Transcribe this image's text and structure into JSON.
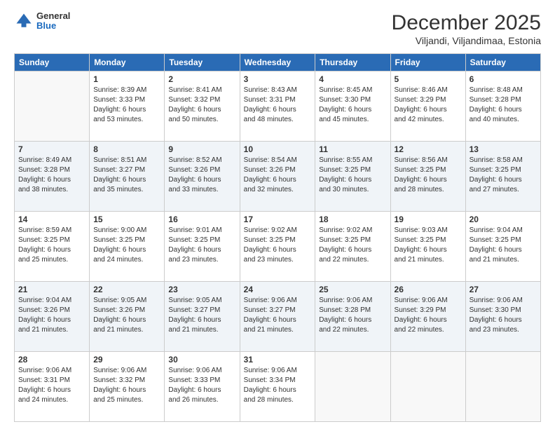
{
  "header": {
    "logo": {
      "general": "General",
      "blue": "Blue"
    },
    "title": "December 2025",
    "subtitle": "Viljandi, Viljandimaa, Estonia"
  },
  "weekdays": [
    "Sunday",
    "Monday",
    "Tuesday",
    "Wednesday",
    "Thursday",
    "Friday",
    "Saturday"
  ],
  "weeks": [
    [
      {
        "day": "",
        "info": ""
      },
      {
        "day": "1",
        "info": "Sunrise: 8:39 AM\nSunset: 3:33 PM\nDaylight: 6 hours\nand 53 minutes."
      },
      {
        "day": "2",
        "info": "Sunrise: 8:41 AM\nSunset: 3:32 PM\nDaylight: 6 hours\nand 50 minutes."
      },
      {
        "day": "3",
        "info": "Sunrise: 8:43 AM\nSunset: 3:31 PM\nDaylight: 6 hours\nand 48 minutes."
      },
      {
        "day": "4",
        "info": "Sunrise: 8:45 AM\nSunset: 3:30 PM\nDaylight: 6 hours\nand 45 minutes."
      },
      {
        "day": "5",
        "info": "Sunrise: 8:46 AM\nSunset: 3:29 PM\nDaylight: 6 hours\nand 42 minutes."
      },
      {
        "day": "6",
        "info": "Sunrise: 8:48 AM\nSunset: 3:28 PM\nDaylight: 6 hours\nand 40 minutes."
      }
    ],
    [
      {
        "day": "7",
        "info": "Sunrise: 8:49 AM\nSunset: 3:28 PM\nDaylight: 6 hours\nand 38 minutes."
      },
      {
        "day": "8",
        "info": "Sunrise: 8:51 AM\nSunset: 3:27 PM\nDaylight: 6 hours\nand 35 minutes."
      },
      {
        "day": "9",
        "info": "Sunrise: 8:52 AM\nSunset: 3:26 PM\nDaylight: 6 hours\nand 33 minutes."
      },
      {
        "day": "10",
        "info": "Sunrise: 8:54 AM\nSunset: 3:26 PM\nDaylight: 6 hours\nand 32 minutes."
      },
      {
        "day": "11",
        "info": "Sunrise: 8:55 AM\nSunset: 3:25 PM\nDaylight: 6 hours\nand 30 minutes."
      },
      {
        "day": "12",
        "info": "Sunrise: 8:56 AM\nSunset: 3:25 PM\nDaylight: 6 hours\nand 28 minutes."
      },
      {
        "day": "13",
        "info": "Sunrise: 8:58 AM\nSunset: 3:25 PM\nDaylight: 6 hours\nand 27 minutes."
      }
    ],
    [
      {
        "day": "14",
        "info": "Sunrise: 8:59 AM\nSunset: 3:25 PM\nDaylight: 6 hours\nand 25 minutes."
      },
      {
        "day": "15",
        "info": "Sunrise: 9:00 AM\nSunset: 3:25 PM\nDaylight: 6 hours\nand 24 minutes."
      },
      {
        "day": "16",
        "info": "Sunrise: 9:01 AM\nSunset: 3:25 PM\nDaylight: 6 hours\nand 23 minutes."
      },
      {
        "day": "17",
        "info": "Sunrise: 9:02 AM\nSunset: 3:25 PM\nDaylight: 6 hours\nand 23 minutes."
      },
      {
        "day": "18",
        "info": "Sunrise: 9:02 AM\nSunset: 3:25 PM\nDaylight: 6 hours\nand 22 minutes."
      },
      {
        "day": "19",
        "info": "Sunrise: 9:03 AM\nSunset: 3:25 PM\nDaylight: 6 hours\nand 21 minutes."
      },
      {
        "day": "20",
        "info": "Sunrise: 9:04 AM\nSunset: 3:25 PM\nDaylight: 6 hours\nand 21 minutes."
      }
    ],
    [
      {
        "day": "21",
        "info": "Sunrise: 9:04 AM\nSunset: 3:26 PM\nDaylight: 6 hours\nand 21 minutes."
      },
      {
        "day": "22",
        "info": "Sunrise: 9:05 AM\nSunset: 3:26 PM\nDaylight: 6 hours\nand 21 minutes."
      },
      {
        "day": "23",
        "info": "Sunrise: 9:05 AM\nSunset: 3:27 PM\nDaylight: 6 hours\nand 21 minutes."
      },
      {
        "day": "24",
        "info": "Sunrise: 9:06 AM\nSunset: 3:27 PM\nDaylight: 6 hours\nand 21 minutes."
      },
      {
        "day": "25",
        "info": "Sunrise: 9:06 AM\nSunset: 3:28 PM\nDaylight: 6 hours\nand 22 minutes."
      },
      {
        "day": "26",
        "info": "Sunrise: 9:06 AM\nSunset: 3:29 PM\nDaylight: 6 hours\nand 22 minutes."
      },
      {
        "day": "27",
        "info": "Sunrise: 9:06 AM\nSunset: 3:30 PM\nDaylight: 6 hours\nand 23 minutes."
      }
    ],
    [
      {
        "day": "28",
        "info": "Sunrise: 9:06 AM\nSunset: 3:31 PM\nDaylight: 6 hours\nand 24 minutes."
      },
      {
        "day": "29",
        "info": "Sunrise: 9:06 AM\nSunset: 3:32 PM\nDaylight: 6 hours\nand 25 minutes."
      },
      {
        "day": "30",
        "info": "Sunrise: 9:06 AM\nSunset: 3:33 PM\nDaylight: 6 hours\nand 26 minutes."
      },
      {
        "day": "31",
        "info": "Sunrise: 9:06 AM\nSunset: 3:34 PM\nDaylight: 6 hours\nand 28 minutes."
      },
      {
        "day": "",
        "info": ""
      },
      {
        "day": "",
        "info": ""
      },
      {
        "day": "",
        "info": ""
      }
    ]
  ]
}
